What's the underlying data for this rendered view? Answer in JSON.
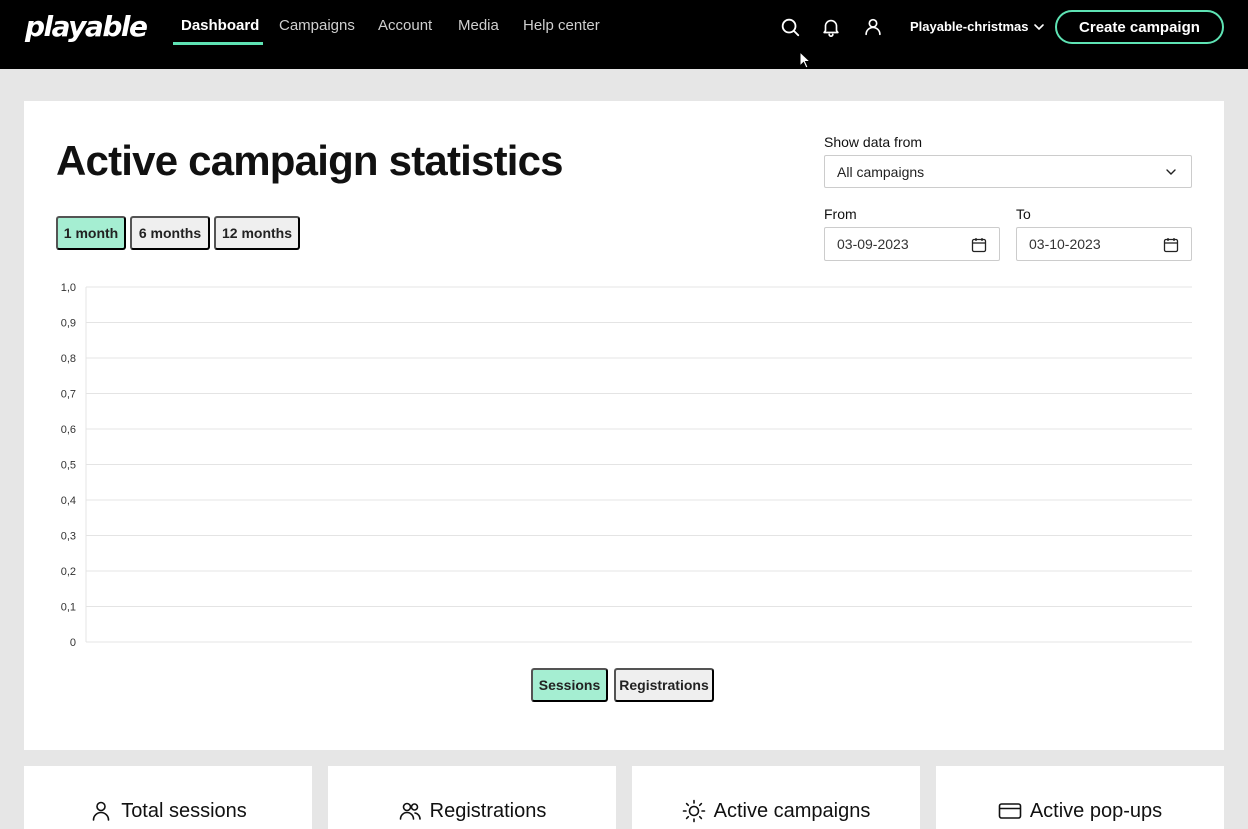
{
  "nav": {
    "logo": "playable",
    "items": [
      {
        "label": "Dashboard",
        "active": true
      },
      {
        "label": "Campaigns"
      },
      {
        "label": "Account"
      },
      {
        "label": "Media"
      },
      {
        "label": "Help center"
      }
    ],
    "icons": [
      "search-icon",
      "bell-icon",
      "user-icon"
    ],
    "account": "Playable-christmas",
    "create_button": "Create campaign",
    "accent_color": "#5ee3b4"
  },
  "main": {
    "title": "Active campaign statistics",
    "ranges": [
      {
        "label": "1 month",
        "selected": true
      },
      {
        "label": "6 months"
      },
      {
        "label": "12 months"
      }
    ],
    "show_data_from": {
      "label": "Show data from",
      "value": "All campaigns"
    },
    "from": {
      "label": "From",
      "value": "03-09-2023"
    },
    "to": {
      "label": "To",
      "value": "03-10-2023"
    },
    "legend": [
      {
        "label": "Sessions",
        "selected": true
      },
      {
        "label": "Registrations"
      }
    ]
  },
  "chart_data": {
    "type": "line",
    "title": "",
    "xlabel": "",
    "ylabel": "",
    "ylim": [
      0,
      1.0
    ],
    "y_ticks": [
      "0",
      "0,1",
      "0,2",
      "0,3",
      "0,4",
      "0,5",
      "0,6",
      "0,7",
      "0,8",
      "0,9",
      "1,0"
    ],
    "grid": true,
    "series": []
  },
  "stats": [
    {
      "label": "Total sessions",
      "icon": "user-icon"
    },
    {
      "label": "Registrations",
      "icon": "users-icon"
    },
    {
      "label": "Active campaigns",
      "icon": "sun-icon"
    },
    {
      "label": "Active pop-ups",
      "icon": "card-icon"
    }
  ]
}
